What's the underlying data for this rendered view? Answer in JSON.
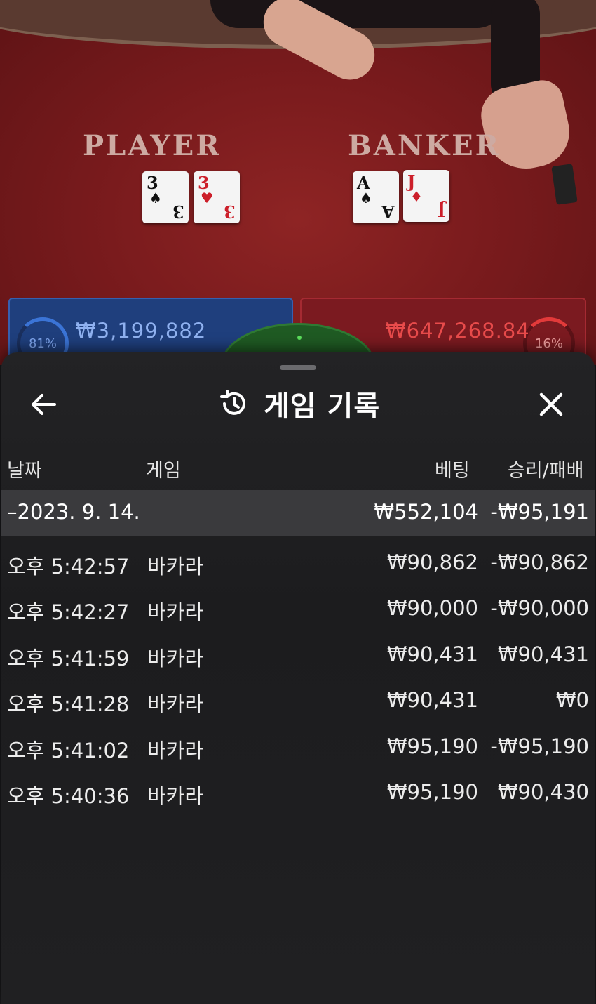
{
  "table": {
    "player_label": "PLAYER",
    "banker_label": "BANKER",
    "player_cards": [
      {
        "rank": "3",
        "suit": "♠",
        "color": "black"
      },
      {
        "rank": "3",
        "suit": "♥",
        "color": "red"
      }
    ],
    "banker_cards": [
      {
        "rank": "A",
        "suit": "♠",
        "color": "black"
      },
      {
        "rank": "J",
        "suit": "♦",
        "color": "red"
      }
    ],
    "player_pct": "81%",
    "banker_pct": "16%",
    "player_amount": "₩3,199,882",
    "banker_amount": "₩647,268.84"
  },
  "sheet": {
    "title": "게임 기록",
    "back_icon": "arrow-left-icon",
    "history_icon": "history-icon",
    "close_icon": "close-icon",
    "columns": {
      "date": "날짜",
      "game": "게임",
      "bet": "베팅",
      "result": "승리/패배"
    },
    "summary": {
      "date": "–2023. 9. 14.",
      "bet": "₩552,104",
      "result": "-₩95,191"
    },
    "rows": [
      {
        "time": "오후 5:42:57",
        "game": "바카라",
        "bet": "₩90,862",
        "result": "-₩90,862"
      },
      {
        "time": "오후 5:42:27",
        "game": "바카라",
        "bet": "₩90,000",
        "result": "-₩90,000"
      },
      {
        "time": "오후 5:41:59",
        "game": "바카라",
        "bet": "₩90,431",
        "result": "₩90,431"
      },
      {
        "time": "오후 5:41:28",
        "game": "바카라",
        "bet": "₩90,431",
        "result": "₩0"
      },
      {
        "time": "오후 5:41:02",
        "game": "바카라",
        "bet": "₩95,190",
        "result": "-₩95,190"
      },
      {
        "time": "오후 5:40:36",
        "game": "바카라",
        "bet": "₩95,190",
        "result": "₩90,430"
      }
    ]
  }
}
